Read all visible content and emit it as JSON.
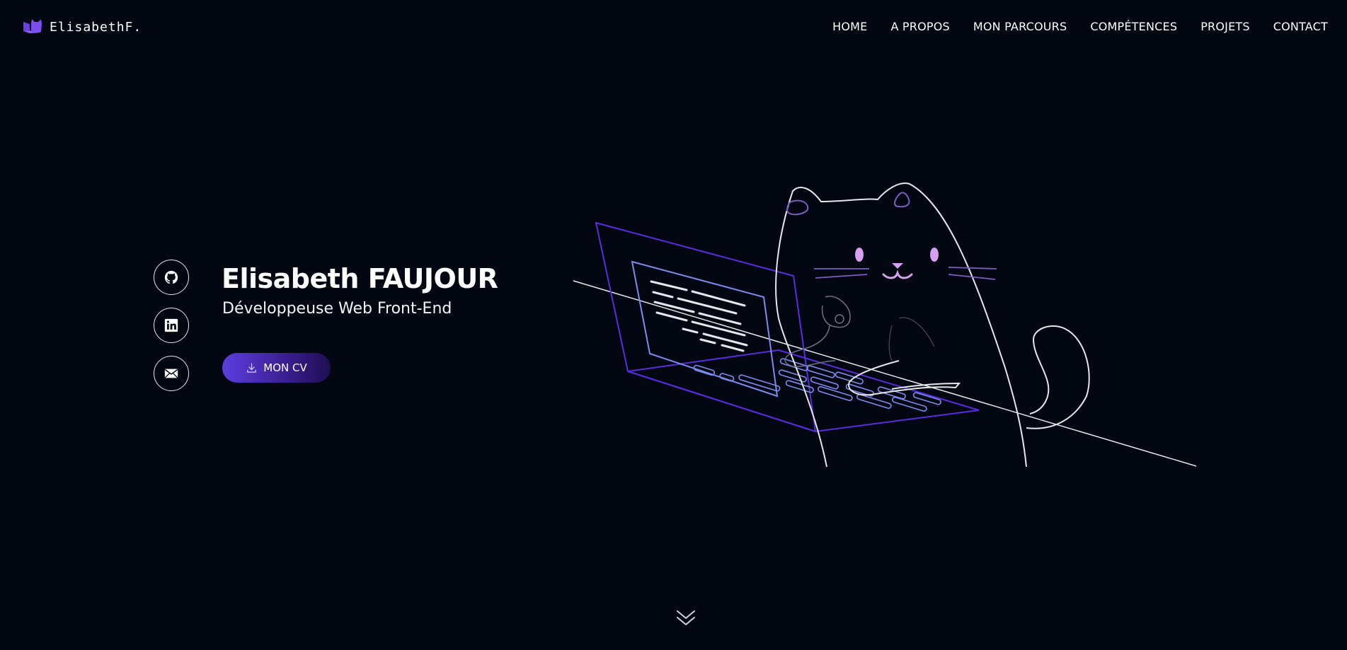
{
  "header": {
    "logo_text": "ElisabethF.",
    "logo_icon": "cat-laptop-logo-icon",
    "nav": [
      {
        "label": "HOME"
      },
      {
        "label": "A PROPOS"
      },
      {
        "label": "MON PARCOURS"
      },
      {
        "label": "COMPÉTENCES"
      },
      {
        "label": "PROJETS"
      },
      {
        "label": "CONTACT"
      }
    ]
  },
  "socials": [
    {
      "icon": "github-icon"
    },
    {
      "icon": "linkedin-icon"
    },
    {
      "icon": "mail-icon"
    }
  ],
  "hero": {
    "name": "Elisabeth FAUJOUR",
    "role": "Développeuse Web Front-End",
    "cv_button": {
      "label": "MON CV",
      "icon": "download-icon"
    }
  },
  "illustration": {
    "description_icon": "cat-coding-illustration"
  },
  "scroll": {
    "icon": "double-chevron-down-icon"
  },
  "colors": {
    "background": "#030712",
    "accent": "#5b3ee0",
    "accent_dark": "#1e0f52",
    "line": "#e5e7eb",
    "purple_line": "#5b2be0",
    "screen_line": "#7b8cf0",
    "pink": "#d8a0f0"
  }
}
